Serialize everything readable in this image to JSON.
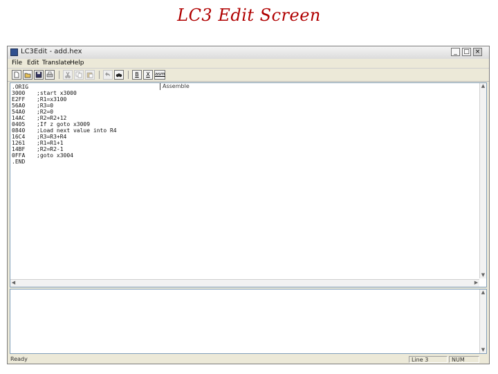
{
  "slide": {
    "title": "LC3 Edit Screen"
  },
  "window": {
    "title": "LC3Edit - add.hex",
    "controls": {
      "minimize": "_",
      "maximize": "□",
      "close": "×"
    }
  },
  "menu": [
    "File",
    "Edit",
    "Translate",
    "Help"
  ],
  "toolbar": {
    "buttons": [
      {
        "name": "new-file-icon"
      },
      {
        "name": "open-folder-icon"
      },
      {
        "name": "save-icon"
      },
      {
        "name": "print-icon"
      },
      {
        "name": "cut-icon"
      },
      {
        "name": "copy-icon"
      },
      {
        "name": "paste-icon"
      },
      {
        "name": "undo-icon"
      },
      {
        "name": "find-icon"
      },
      {
        "name": "binary-icon",
        "label": "B"
      },
      {
        "name": "hex-icon",
        "label": "X"
      },
      {
        "name": "asm-icon",
        "label": "asm"
      }
    ]
  },
  "editor": {
    "header": "Assemble",
    "lines": [
      {
        "code": ".ORIG",
        "comment": ""
      },
      {
        "code": "3000",
        "comment": ";start x3000"
      },
      {
        "code": "E2FF",
        "comment": ";R1=x3100"
      },
      {
        "code": "56A0",
        "comment": ";R3=0"
      },
      {
        "code": "54A0",
        "comment": ";R2=0"
      },
      {
        "code": "14AC",
        "comment": ";R2=R2+12"
      },
      {
        "code": "0405",
        "comment": ";If z goto x3009"
      },
      {
        "code": "0840",
        "comment": ";Load next value into R4"
      },
      {
        "code": "16C4",
        "comment": ";R3=R3+R4"
      },
      {
        "code": "1261",
        "comment": ";R1=R1+1"
      },
      {
        "code": "14BF",
        "comment": ";R2=R2-1"
      },
      {
        "code": "0FFA",
        "comment": ";goto x3004"
      },
      {
        "code": ".END",
        "comment": ""
      }
    ]
  },
  "statusbar": {
    "ready": "Ready",
    "line": "Line 3",
    "mode": "NUM"
  },
  "colors": {
    "title_red": "#b00000",
    "chrome": "#ece9d8",
    "pane_border": "#7f9db9"
  }
}
